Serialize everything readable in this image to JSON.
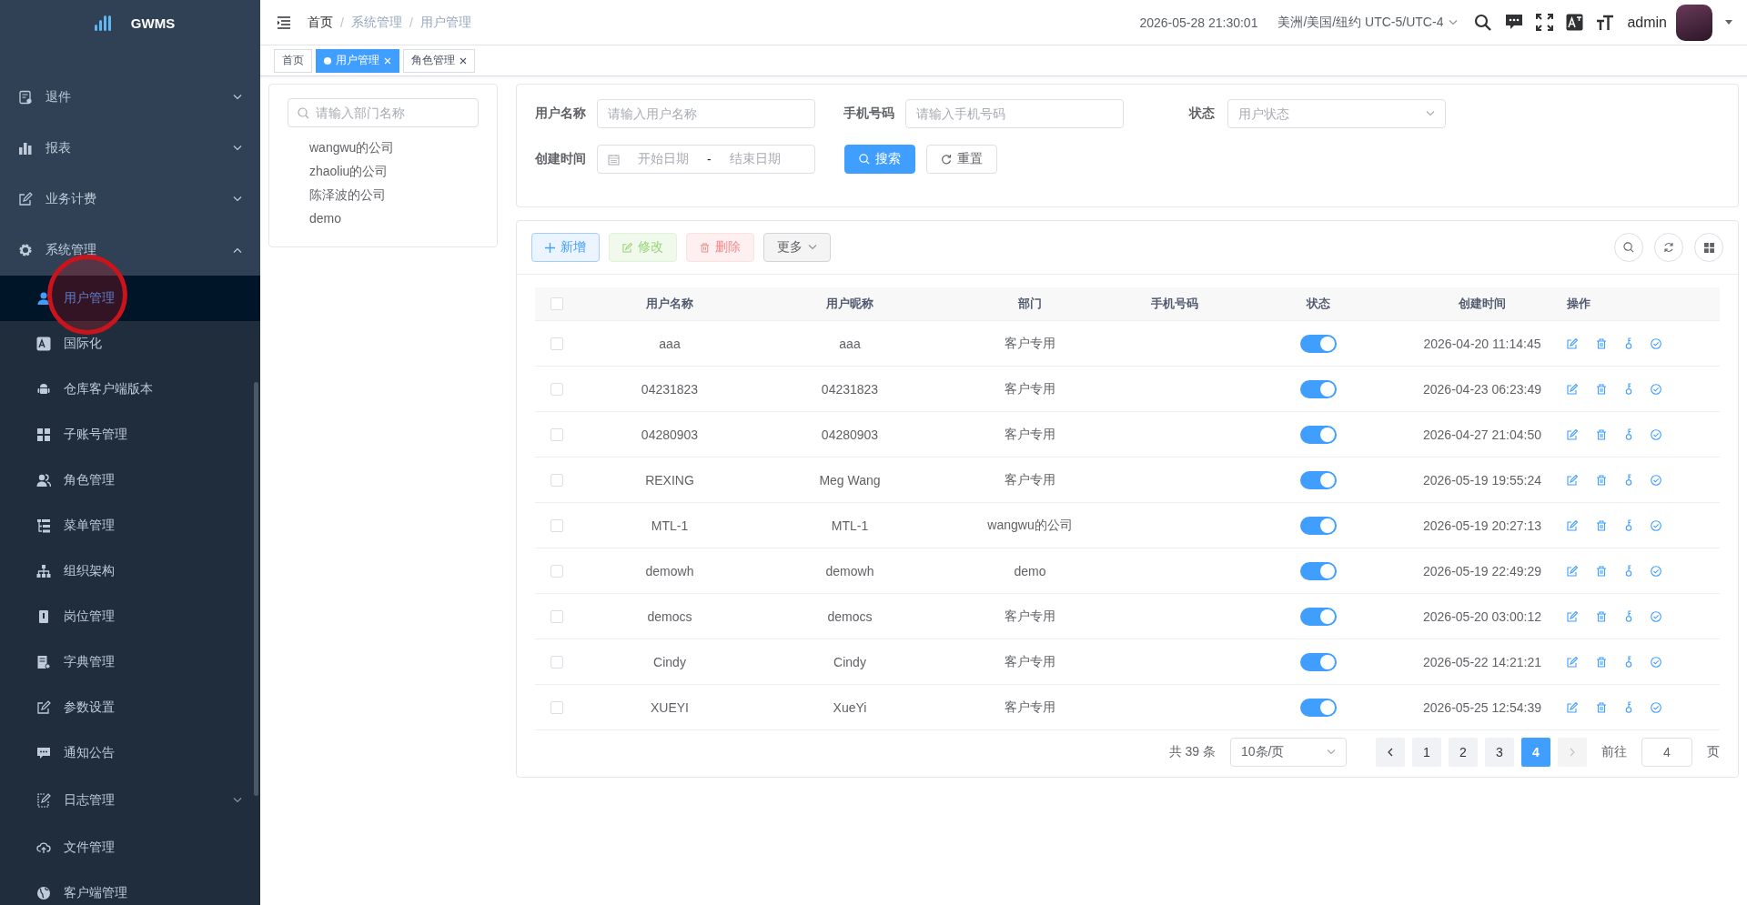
{
  "app": {
    "logo": "GWMS"
  },
  "sidebar": {
    "items": [
      {
        "label": "退件",
        "kind": "group",
        "expanded": false
      },
      {
        "label": "报表",
        "kind": "group",
        "expanded": false
      },
      {
        "label": "业务计费",
        "kind": "group",
        "expanded": false
      },
      {
        "label": "系统管理",
        "kind": "group",
        "expanded": true,
        "children": [
          {
            "label": "用户管理",
            "kind": "link",
            "selected": true
          },
          {
            "label": "国际化",
            "kind": "link",
            "selected": false
          },
          {
            "label": "仓库客户端版本",
            "kind": "link",
            "selected": false
          },
          {
            "label": "子账号管理",
            "kind": "link",
            "selected": false
          },
          {
            "label": "角色管理",
            "kind": "link",
            "selected": false
          },
          {
            "label": "菜单管理",
            "kind": "link",
            "selected": false
          },
          {
            "label": "组织架构",
            "kind": "link",
            "selected": false
          },
          {
            "label": "岗位管理",
            "kind": "link",
            "selected": false
          },
          {
            "label": "字典管理",
            "kind": "link",
            "selected": false
          },
          {
            "label": "参数设置",
            "kind": "link",
            "selected": false
          },
          {
            "label": "通知公告",
            "kind": "link",
            "selected": false
          },
          {
            "label": "日志管理",
            "kind": "group",
            "selected": false,
            "expanded": false
          },
          {
            "label": "文件管理",
            "kind": "link",
            "selected": false
          },
          {
            "label": "客户端管理",
            "kind": "link",
            "selected": false
          }
        ]
      }
    ]
  },
  "header": {
    "breadcrumb": [
      "首页",
      "系统管理",
      "用户管理"
    ],
    "breadcrumb_separator": "/",
    "datetime": "2026-05-28 21:30:01",
    "timezone": "美洲/美国/纽约 UTC-5/UTC-4",
    "user": "admin"
  },
  "tabs": [
    {
      "label": "首页",
      "selected": false,
      "closable": false
    },
    {
      "label": "用户管理",
      "selected": true,
      "closable": true
    },
    {
      "label": "角色管理",
      "selected": false,
      "closable": true
    }
  ],
  "dept_tree": {
    "placeholder": "请输入部门名称",
    "items": [
      "wangwu的公司",
      "zhaoliu的公司",
      "陈泽波的公司",
      "demo"
    ]
  },
  "search_form": {
    "username": {
      "label": "用户名称",
      "placeholder": "请输入用户名称"
    },
    "phone": {
      "label": "手机号码",
      "placeholder": "请输入手机号码"
    },
    "status": {
      "label": "状态",
      "placeholder": "用户状态"
    },
    "created": {
      "label": "创建时间",
      "start_placeholder": "开始日期",
      "separator": "-",
      "end_placeholder": "结束日期"
    },
    "search_button": "搜索",
    "reset_button": "重置"
  },
  "toolbar": [
    {
      "label": "新增",
      "kind": "add",
      "disabled": false
    },
    {
      "label": "修改",
      "kind": "edit",
      "disabled": true
    },
    {
      "label": "删除",
      "kind": "delete",
      "disabled": true
    },
    {
      "label": "更多",
      "kind": "more",
      "disabled": false
    }
  ],
  "table": {
    "select_all_checked": false,
    "columns": [
      "用户名称",
      "用户昵称",
      "部门",
      "手机号码",
      "状态",
      "创建时间",
      "操作"
    ],
    "rows": [
      {
        "checked": false,
        "username": "aaa",
        "nickname": "aaa",
        "dept": "客户专用",
        "on": true,
        "created": "2026-04-20 11:14:45"
      },
      {
        "checked": false,
        "username": "04231823",
        "nickname": "04231823",
        "dept": "客户专用",
        "on": true,
        "created": "2026-04-23 06:23:49"
      },
      {
        "checked": false,
        "username": "04280903",
        "nickname": "04280903",
        "dept": "客户专用",
        "on": true,
        "created": "2026-04-27 21:04:50"
      },
      {
        "checked": false,
        "username": "REXING",
        "nickname": "Meg Wang",
        "dept": "客户专用",
        "on": true,
        "created": "2026-05-19 19:55:24"
      },
      {
        "checked": false,
        "username": "MTL-1",
        "nickname": "MTL-1",
        "dept": "wangwu的公司",
        "on": true,
        "created": "2026-05-19 20:27:13"
      },
      {
        "checked": false,
        "username": "demowh",
        "nickname": "demowh",
        "dept": "demo",
        "on": true,
        "created": "2026-05-19 22:49:29"
      },
      {
        "checked": false,
        "username": "democs",
        "nickname": "democs",
        "dept": "客户专用",
        "on": true,
        "created": "2026-05-20 03:00:12"
      },
      {
        "checked": false,
        "username": "Cindy",
        "nickname": "Cindy",
        "dept": "客户专用",
        "on": true,
        "created": "2026-05-22 14:21:21"
      },
      {
        "checked": false,
        "username": "XUEYI",
        "nickname": "XueYi",
        "dept": "客户专用",
        "on": true,
        "created": "2026-05-25 12:54:39"
      }
    ]
  },
  "pagination": {
    "total": "共 39 条",
    "page_size": "10条/页",
    "prev_disabled": false,
    "next_disabled": true,
    "pages": [
      {
        "label": "1",
        "selected": false
      },
      {
        "label": "2",
        "selected": false
      },
      {
        "label": "3",
        "selected": false
      },
      {
        "label": "4",
        "selected": true
      }
    ],
    "goto_label": "前往",
    "goto_value": "4",
    "goto_suffix": "页"
  }
}
